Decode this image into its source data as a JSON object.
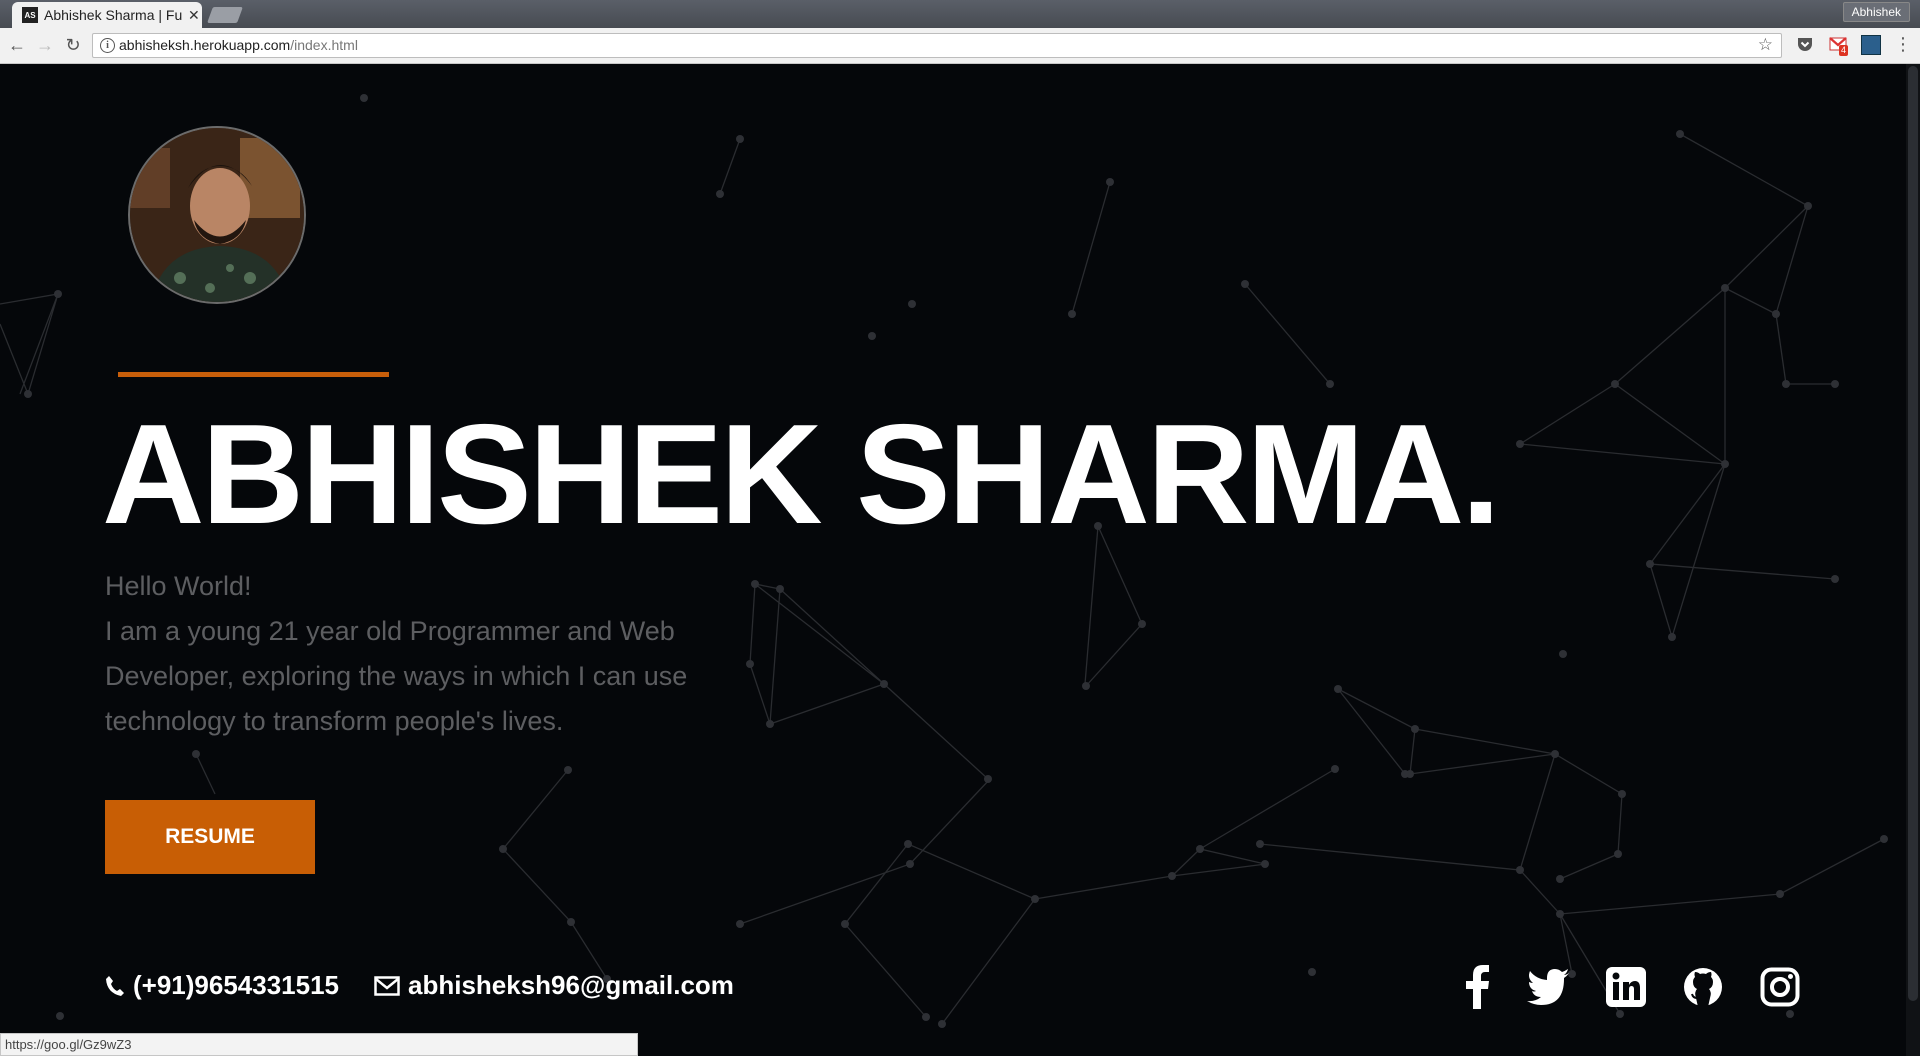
{
  "browser": {
    "tab_title": "Abhishek Sharma | Fu",
    "favicon_text": "AS",
    "profile_name": "Abhishek",
    "url_host": "abhisheksh.herokuapp.com",
    "url_path": "/index.html",
    "status_url": "https://goo.gl/Gz9wZ3",
    "gmail_count": "4",
    "icons": [
      "back-icon",
      "forward-icon",
      "reload-icon",
      "info-icon",
      "star-icon",
      "pocket-icon",
      "gmail-icon",
      "extension-icon",
      "menu-icon"
    ]
  },
  "hero": {
    "name": "ABHISHEK SHARMA.",
    "greeting": "Hello World!",
    "bio": "I am a young 21 year old Programmer and Web Developer, exploring the ways in which I can use technology to transform people's lives.",
    "resume_label": "RESUME",
    "accent_color": "#c85e05"
  },
  "contact": {
    "phone": "(+91)9654331515",
    "email": "abhisheksh96@gmail.com"
  },
  "social": [
    "facebook-icon",
    "twitter-icon",
    "linkedin-icon",
    "github-icon",
    "instagram-icon"
  ]
}
